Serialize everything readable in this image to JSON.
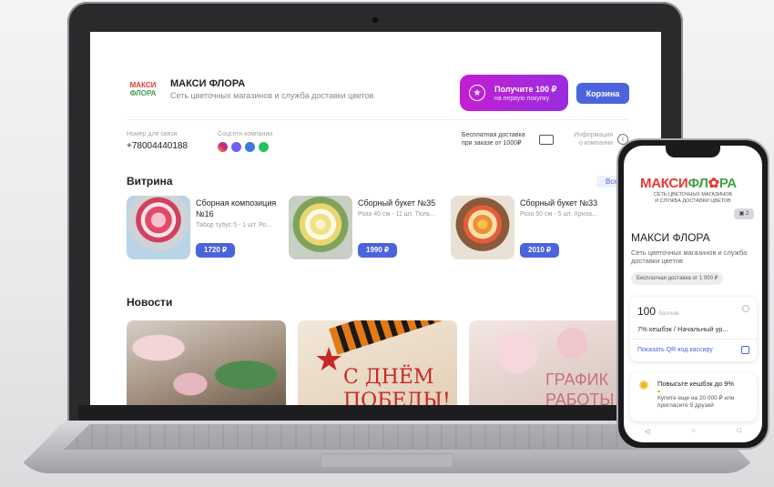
{
  "site": {
    "logo_line1": "МАКСИ",
    "logo_line2": "ФЛОРА",
    "brand_name": "МАКСИ ФЛОРА",
    "brand_subtitle": "Сеть цветочных магазинов и служба доставки цветов"
  },
  "header": {
    "promo_main": "Получите 100 ₽",
    "promo_sub": "на первую покупку",
    "cart_label": "Корзина"
  },
  "contacts": {
    "phone_label": "Номер для связи",
    "phone": "+78004440188",
    "social_label": "Соцсети компании",
    "social_icons": [
      "instagram-icon",
      "viber-icon",
      "vk-icon",
      "whatsapp-icon"
    ],
    "delivery_line1": "Бесплатная доставка",
    "delivery_line2": "при заказе от 1000₽",
    "info_line1": "Информация",
    "info_line2": "о компании"
  },
  "showcase": {
    "title": "Витрина",
    "all_label": "Все",
    "products": [
      {
        "name": "Сборная композиция №16",
        "desc": "Табор тубус 5 - 1 шт. Ро...",
        "price": "1720 ₽"
      },
      {
        "name": "Сборный букет №35",
        "desc": "Роза 40 см - 11 шт. Тюль...",
        "price": "1990 ₽"
      },
      {
        "name": "Сборный букет №33",
        "desc": "Роза 50 см - 5 шт. Хриза...",
        "price": "2010 ₽"
      }
    ]
  },
  "news": {
    "title": "Новости",
    "items": [
      {
        "text": ""
      },
      {
        "line1": "С ДНЁМ",
        "line2": "ПОБЕДЫ!"
      },
      {
        "line1": "ГРАФИК",
        "line2": "РАБОТЫ"
      }
    ]
  },
  "mobile": {
    "logo_a": "МАКСИ",
    "logo_b": "ФЛ",
    "logo_c": "✿",
    "logo_d": "РА",
    "logo_sub_line1": "СЕТЬ ЦВЕТОЧНЫХ МАГАЗИНОВ",
    "logo_sub_line2": "И СЛУЖБА ДОСТАВКИ ЦВЕТОВ",
    "photo_badge": "2",
    "title": "МАКСИ ФЛОРА",
    "subtitle": "Сеть цветочных магазинов и служба доставки цветов",
    "delivery_tag": "Бесплатная доставка от 1 000 ₽",
    "points_value": "100",
    "points_unit": "баллов",
    "cashback": "7% кешбэк / Начальный ур...",
    "qr_label": "Показать QR-код кассиру",
    "upgrade_title": "Повысьте кешбэк до 9%",
    "upgrade_text": "Купите еще на 20 000 ₽ или пригласите 5 друзей",
    "nav": [
      "◁",
      "○",
      "□"
    ]
  },
  "colors": {
    "accent": "#4b64dc",
    "promo_start": "#c21fd2",
    "promo_end": "#9b2be0",
    "logo_red": "#e53935",
    "logo_green": "#43a047"
  }
}
